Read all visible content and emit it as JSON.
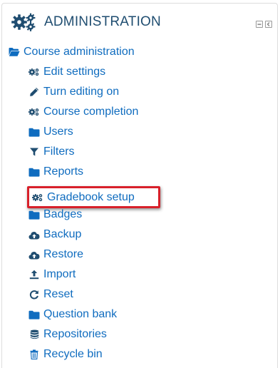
{
  "block": {
    "title": "ADMINISTRATION",
    "icon": "gears-icon",
    "controls": [
      {
        "name": "collapse-block-control",
        "icon": "minus-icon"
      },
      {
        "name": "dock-block-control",
        "icon": "chevron-left-icon"
      }
    ]
  },
  "tree": {
    "root": {
      "label": "Course administration",
      "icon": "folder-open-icon"
    },
    "items": [
      {
        "label": "Edit settings",
        "icon": "gears-icon"
      },
      {
        "label": "Turn editing on",
        "icon": "pencil-icon"
      },
      {
        "label": "Course completion",
        "icon": "gears-icon"
      },
      {
        "label": "Users",
        "icon": "folder-icon"
      },
      {
        "label": "Filters",
        "icon": "filter-icon"
      },
      {
        "label": "Reports",
        "icon": "folder-icon"
      },
      {
        "label": "Gradebook setup",
        "icon": "gears-icon"
      },
      {
        "label": "Badges",
        "icon": "folder-icon"
      },
      {
        "label": "Backup",
        "icon": "cloud-upload-icon"
      },
      {
        "label": "Restore",
        "icon": "cloud-upload-icon"
      },
      {
        "label": "Import",
        "icon": "upload-icon"
      },
      {
        "label": "Reset",
        "icon": "reset-icon"
      },
      {
        "label": "Question bank",
        "icon": "folder-icon"
      },
      {
        "label": "Repositories",
        "icon": "database-icon"
      },
      {
        "label": "Recycle bin",
        "icon": "trash-icon"
      }
    ],
    "highlighted_item": "Gradebook setup"
  },
  "colors": {
    "title": "#1f4d70",
    "link": "#0f6cbf",
    "icon_dark": "#1f4d70",
    "highlight": "#d8202a"
  }
}
